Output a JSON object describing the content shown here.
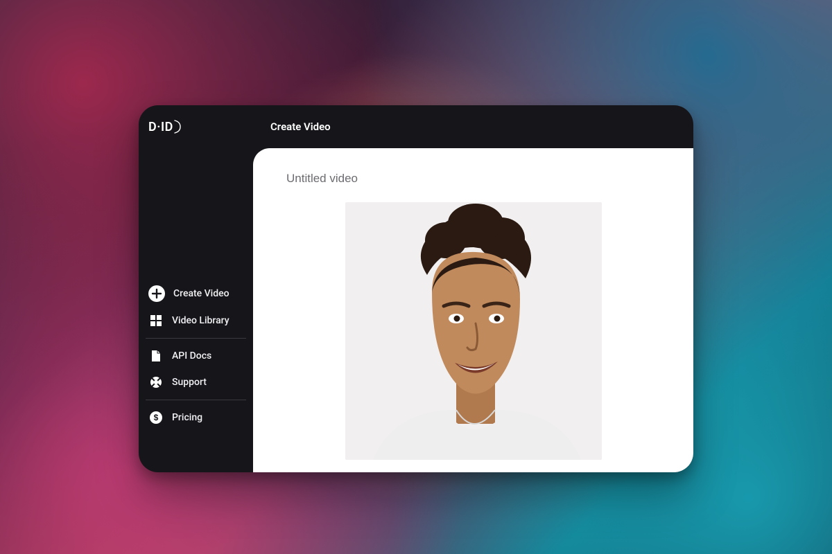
{
  "brand": {
    "name": "D·ID"
  },
  "header": {
    "page_title": "Create Video"
  },
  "sidebar": {
    "items": [
      {
        "label": "Create Video",
        "icon": "plus-circle-icon"
      },
      {
        "label": "Video Library",
        "icon": "grid-icon"
      },
      {
        "label": "API Docs",
        "icon": "document-icon"
      },
      {
        "label": "Support",
        "icon": "lifebuoy-icon"
      },
      {
        "label": "Pricing",
        "icon": "dollar-circle-icon"
      }
    ]
  },
  "editor": {
    "title_value": "Untitled video",
    "preview_presenter": "default-presenter"
  }
}
